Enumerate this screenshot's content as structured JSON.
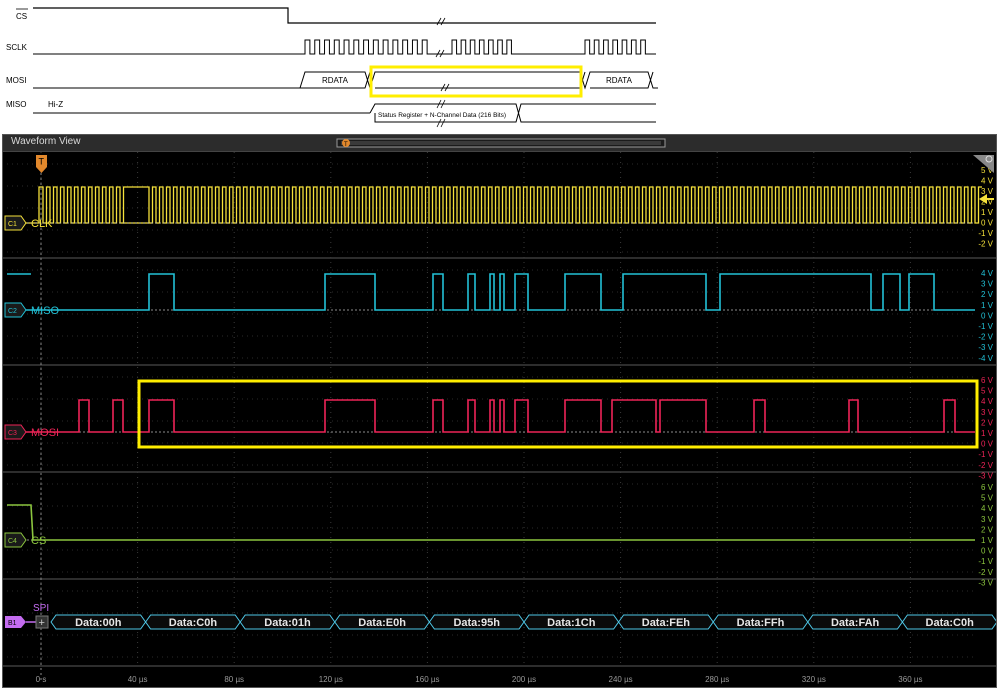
{
  "timing_diagram": {
    "signals": [
      {
        "name": "CS",
        "overline": true
      },
      {
        "name": "SCLK"
      },
      {
        "name": "MOSI"
      },
      {
        "name": "MISO"
      }
    ],
    "miso_idle": "Hi-Z",
    "mosi_field_left": "RDATA",
    "mosi_field_right": "RDATA",
    "miso_field": "Status Register + N-Channel Data (216 Bits)"
  },
  "scope": {
    "title": "Waveform View",
    "trigger_marker": "T",
    "channels": [
      {
        "id": "C1",
        "name": "CLK",
        "color": "#f5e13a",
        "scale": [
          "5 V",
          "4 V",
          "3 V",
          "2 V",
          "1 V",
          "0 V",
          "-1 V",
          "-2 V"
        ]
      },
      {
        "id": "C2",
        "name": "MISO",
        "color": "#22c1d6",
        "scale": [
          "4 V",
          "3 V",
          "2 V",
          "1 V",
          "0 V",
          "-1 V",
          "-2 V",
          "-3 V",
          "-4 V"
        ]
      },
      {
        "id": "C3",
        "name": "MOSI",
        "color": "#ee2457",
        "scale": [
          "6 V",
          "5 V",
          "4 V",
          "3 V",
          "2 V",
          "1 V",
          "0 V",
          "-1 V",
          "-2 V",
          "-3 V"
        ]
      },
      {
        "id": "C4",
        "name": "CS",
        "color": "#8cc63f",
        "scale": [
          "6 V",
          "5 V",
          "4 V",
          "3 V",
          "2 V",
          "1 V",
          "0 V",
          "-1 V",
          "-2 V",
          "-3 V"
        ]
      }
    ],
    "bus": {
      "id": "B1",
      "name": "SPI",
      "color": "#c46cf0",
      "packets": [
        "Data:00h",
        "Data:C0h",
        "Data:01h",
        "Data:E0h",
        "Data:95h",
        "Data:1Ch",
        "Data:FEh",
        "Data:FFh",
        "Data:FAh",
        "Data:C0h"
      ]
    },
    "time_axis": [
      "0 s",
      "40 µs",
      "80 µs",
      "120 µs",
      "160 µs",
      "200 µs",
      "240 µs",
      "280 µs",
      "320 µs",
      "360 µs"
    ],
    "highlight_color": "#ffee00"
  }
}
